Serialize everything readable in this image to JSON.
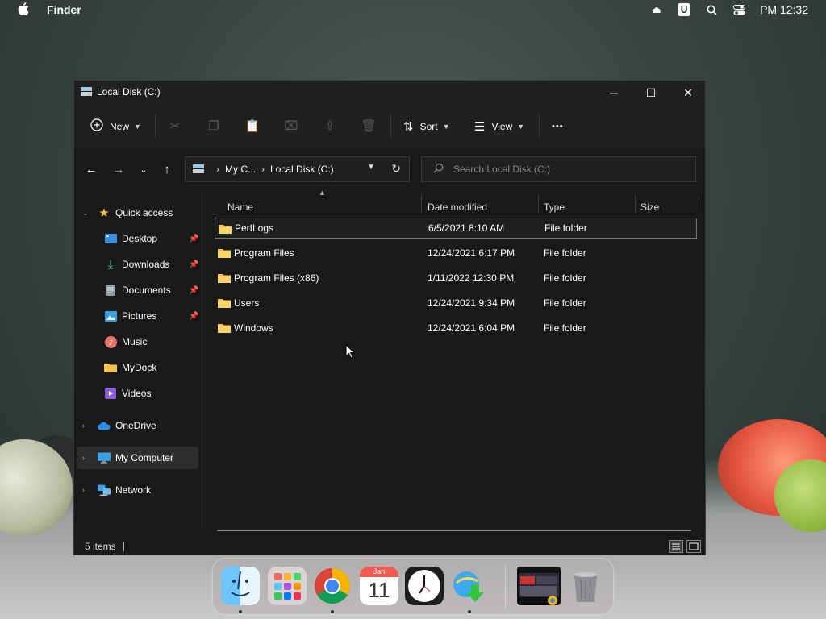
{
  "menubar": {
    "app_name": "Finder",
    "clock": "PM 12:32",
    "u_badge": "U"
  },
  "window": {
    "title": "Local Disk (C:)",
    "controls": {
      "minimize": "─",
      "maximize": "☐",
      "close": "✕"
    }
  },
  "toolbar": {
    "new_label": "New",
    "sort_label": "Sort",
    "view_label": "View",
    "more_label": "•••"
  },
  "address": {
    "crumb_root": "My C...",
    "crumb_current": "Local Disk (C:)",
    "search_placeholder": "Search Local Disk (C:)"
  },
  "sidebar": {
    "quick_access": "Quick access",
    "items": [
      {
        "label": "Desktop",
        "icon": "desktop-icon"
      },
      {
        "label": "Downloads",
        "icon": "download-icon"
      },
      {
        "label": "Documents",
        "icon": "document-icon"
      },
      {
        "label": "Pictures",
        "icon": "picture-icon"
      },
      {
        "label": "Music",
        "icon": "music-icon"
      },
      {
        "label": "MyDock",
        "icon": "folder-icon"
      },
      {
        "label": "Videos",
        "icon": "video-icon"
      }
    ],
    "onedrive": "OneDrive",
    "my_computer": "My Computer",
    "network": "Network"
  },
  "columns": {
    "name": "Name",
    "date": "Date modified",
    "type": "Type",
    "size": "Size"
  },
  "files": [
    {
      "name": "PerfLogs",
      "date": "6/5/2021 8:10 AM",
      "type": "File folder"
    },
    {
      "name": "Program Files",
      "date": "12/24/2021 6:17 PM",
      "type": "File folder"
    },
    {
      "name": "Program Files (x86)",
      "date": "1/11/2022 12:30 PM",
      "type": "File folder"
    },
    {
      "name": "Users",
      "date": "12/24/2021 9:34 PM",
      "type": "File folder"
    },
    {
      "name": "Windows",
      "date": "12/24/2021 6:04 PM",
      "type": "File folder"
    }
  ],
  "status": {
    "item_count": "5 items"
  },
  "dock": {
    "calendar_month": "Jan",
    "calendar_day": "11"
  },
  "colors": {
    "folder": "#f2c14e",
    "window_bg": "#191919",
    "accent": "#4cc2ff"
  }
}
